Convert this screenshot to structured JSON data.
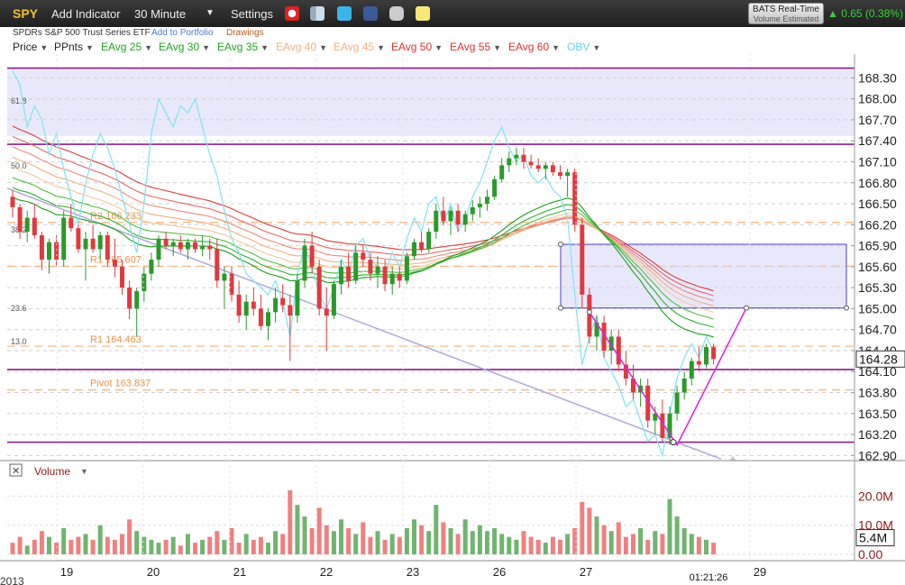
{
  "toolbar": {
    "symbol": "SPY",
    "add_indicator": "Add Indicator",
    "interval": "30 Minute",
    "settings": "Settings",
    "realtime_title": "BATS Real-Time",
    "realtime_sub": "Volume Estimated",
    "change": "0.65 (0.38%)",
    "change_arrow": "▲",
    "icons": [
      "alarm-clock-icon",
      "bookmark-icon",
      "twitter-icon",
      "facebook-icon",
      "camera-icon",
      "note-icon"
    ]
  },
  "subheader": {
    "name": "SPDRs S&P 500 Trust Series ETF",
    "add_portfolio": "Add to Portfolio",
    "drawings": "Drawings"
  },
  "indicators": [
    {
      "label": "Price",
      "color": "#222222"
    },
    {
      "label": "PPnts",
      "color": "#222222"
    },
    {
      "label": "EAvg 25",
      "color": "#1fa51f"
    },
    {
      "label": "EAvg 30",
      "color": "#1fa51f"
    },
    {
      "label": "EAvg 35",
      "color": "#1fa51f"
    },
    {
      "label": "EAvg 40",
      "color": "#f4b183"
    },
    {
      "label": "EAvg 45",
      "color": "#f4b183"
    },
    {
      "label": "EAvg 50",
      "color": "#e03030"
    },
    {
      "label": "EAvg 55",
      "color": "#e03030"
    },
    {
      "label": "EAvg 60",
      "color": "#e03030"
    },
    {
      "label": "OBV",
      "color": "#5bd6ea"
    }
  ],
  "colors": {
    "up": "#2a9a2a",
    "down": "#e0393f",
    "vol_up": "#6fb56f",
    "vol_down": "#f08080",
    "obv": "#7fe3f0",
    "channel": "#8c1e8c",
    "zone": "#e9e9fb",
    "pivot": "#f5b47a",
    "trend": "#b0a8d8",
    "pattern": "#e020e0"
  },
  "chart_data": {
    "type": "candlestick",
    "price_axis": {
      "ticks": [
        "168.30",
        "168.00",
        "167.70",
        "167.40",
        "167.10",
        "166.80",
        "166.50",
        "166.20",
        "165.90",
        "165.60",
        "165.30",
        "165.00",
        "164.70",
        "164.40",
        "164.10",
        "163.80",
        "163.50",
        "163.20",
        "162.90"
      ],
      "ylim": [
        162.84,
        168.64
      ],
      "current_price": "164.28"
    },
    "x_axis_labels": [
      "19",
      "20",
      "21",
      "22",
      "23",
      "26",
      "27",
      "29"
    ],
    "year_label": "2013",
    "timestamp": "01:21:26",
    "fib_labels": [
      "61.8",
      "50.0",
      "38.2",
      "23.6",
      "13.0"
    ],
    "pivots": [
      {
        "label": "R2 166.233",
        "value": 166.233
      },
      {
        "label": "R1 165.607",
        "value": 165.607
      },
      {
        "label": "R1 164.463",
        "value": 164.463
      },
      {
        "label": "Pivot 163.837",
        "value": 163.837
      }
    ],
    "horizontal_levels": [
      168.44,
      167.35,
      164.13,
      163.09
    ],
    "resistance_zone": {
      "from": 167.47,
      "to": 168.44
    },
    "box_zone": {
      "from": 165.01,
      "to": 165.92,
      "x_from": "26",
      "x_to": "29"
    },
    "volume_panel": {
      "title": "Volume",
      "ticks": [
        "20.0M",
        "10.0M",
        "0.00"
      ],
      "current": "5.4M",
      "ylim": [
        0,
        26
      ]
    },
    "candles": [
      [
        166.6,
        166.7,
        166.3,
        166.45
      ],
      [
        166.45,
        166.5,
        166.0,
        166.1
      ],
      [
        166.1,
        166.4,
        165.95,
        166.3
      ],
      [
        166.3,
        166.5,
        166.0,
        166.05
      ],
      [
        166.05,
        166.1,
        165.55,
        165.7
      ],
      [
        165.7,
        166.0,
        165.5,
        165.95
      ],
      [
        165.95,
        166.05,
        165.6,
        165.7
      ],
      [
        165.7,
        166.4,
        165.6,
        166.3
      ],
      [
        166.3,
        166.5,
        166.1,
        166.15
      ],
      [
        166.15,
        166.2,
        165.8,
        165.85
      ],
      [
        165.85,
        166.1,
        165.4,
        166.0
      ],
      [
        166.0,
        166.2,
        165.8,
        165.85
      ],
      [
        165.85,
        166.1,
        165.7,
        166.05
      ],
      [
        166.05,
        166.1,
        165.6,
        165.7
      ],
      [
        165.7,
        166.0,
        165.45,
        165.6
      ],
      [
        165.6,
        165.7,
        165.2,
        165.3
      ],
      [
        165.3,
        165.4,
        164.85,
        165.0
      ],
      [
        165.0,
        165.3,
        164.6,
        165.25
      ],
      [
        165.25,
        165.6,
        165.1,
        165.5
      ],
      [
        165.5,
        165.8,
        165.4,
        165.7
      ],
      [
        165.7,
        166.05,
        165.6,
        166.0
      ],
      [
        166.0,
        166.1,
        165.85,
        165.9
      ],
      [
        165.9,
        166.0,
        165.75,
        165.95
      ],
      [
        165.95,
        166.05,
        165.8,
        165.85
      ],
      [
        165.85,
        166.0,
        165.7,
        165.95
      ],
      [
        165.95,
        166.0,
        165.8,
        165.85
      ],
      [
        165.85,
        166.05,
        165.75,
        165.9
      ],
      [
        165.9,
        166.0,
        165.7,
        165.85
      ],
      [
        165.85,
        166.0,
        165.3,
        165.4
      ],
      [
        165.4,
        165.6,
        165.0,
        165.5
      ],
      [
        165.5,
        165.6,
        165.1,
        165.2
      ],
      [
        165.2,
        165.4,
        164.8,
        164.9
      ],
      [
        164.9,
        165.2,
        164.7,
        165.1
      ],
      [
        165.1,
        165.3,
        164.9,
        165.0
      ],
      [
        165.0,
        165.2,
        164.7,
        164.75
      ],
      [
        164.75,
        165.0,
        164.55,
        164.95
      ],
      [
        164.95,
        165.3,
        164.8,
        165.15
      ],
      [
        165.15,
        165.35,
        164.95,
        165.05
      ],
      [
        165.05,
        165.2,
        164.25,
        164.9
      ],
      [
        164.9,
        165.5,
        164.8,
        165.4
      ],
      [
        165.4,
        166.0,
        165.3,
        165.9
      ],
      [
        165.9,
        166.1,
        165.5,
        165.6
      ],
      [
        165.6,
        165.7,
        164.9,
        165.0
      ],
      [
        165.0,
        165.3,
        164.4,
        164.9
      ],
      [
        164.9,
        165.4,
        164.85,
        165.35
      ],
      [
        165.35,
        165.7,
        165.2,
        165.6
      ],
      [
        165.6,
        165.8,
        165.3,
        165.4
      ],
      [
        165.4,
        165.9,
        165.35,
        165.8
      ],
      [
        165.8,
        165.9,
        165.6,
        165.7
      ],
      [
        165.7,
        165.8,
        165.4,
        165.5
      ],
      [
        165.5,
        165.75,
        165.3,
        165.6
      ],
      [
        165.6,
        165.7,
        165.25,
        165.35
      ],
      [
        165.35,
        165.6,
        165.2,
        165.5
      ],
      [
        165.5,
        165.6,
        165.3,
        165.4
      ],
      [
        165.4,
        165.8,
        165.35,
        165.75
      ],
      [
        165.75,
        166.0,
        165.7,
        165.95
      ],
      [
        165.95,
        166.1,
        165.8,
        165.85
      ],
      [
        165.85,
        166.15,
        165.8,
        166.1
      ],
      [
        166.1,
        166.5,
        166.0,
        166.4
      ],
      [
        166.4,
        166.6,
        166.2,
        166.25
      ],
      [
        166.25,
        166.45,
        166.05,
        166.4
      ],
      [
        166.4,
        166.5,
        166.1,
        166.2
      ],
      [
        166.2,
        166.4,
        166.1,
        166.35
      ],
      [
        166.35,
        166.55,
        166.25,
        166.45
      ],
      [
        166.45,
        166.6,
        166.3,
        166.5
      ],
      [
        166.5,
        166.7,
        166.4,
        166.6
      ],
      [
        166.6,
        166.9,
        166.55,
        166.85
      ],
      [
        166.85,
        167.15,
        166.8,
        167.05
      ],
      [
        167.05,
        167.25,
        166.95,
        167.15
      ],
      [
        167.15,
        167.3,
        167.05,
        167.2
      ],
      [
        167.2,
        167.3,
        167.0,
        167.1
      ],
      [
        167.1,
        167.2,
        167.0,
        167.05
      ],
      [
        167.05,
        167.15,
        166.95,
        167.0
      ],
      [
        167.0,
        167.1,
        166.85,
        167.05
      ],
      [
        167.05,
        167.1,
        166.9,
        166.95
      ],
      [
        166.95,
        167.05,
        166.85,
        166.9
      ],
      [
        166.9,
        167.0,
        166.6,
        166.95
      ],
      [
        166.95,
        167.0,
        166.1,
        166.2
      ],
      [
        166.2,
        166.3,
        165.0,
        165.2
      ],
      [
        165.2,
        165.3,
        164.5,
        164.6
      ],
      [
        164.6,
        164.9,
        164.4,
        164.8
      ],
      [
        164.8,
        164.9,
        164.3,
        164.4
      ],
      [
        164.4,
        164.7,
        164.2,
        164.6
      ],
      [
        164.6,
        164.7,
        164.1,
        164.2
      ],
      [
        164.2,
        164.4,
        163.9,
        164.0
      ],
      [
        164.0,
        164.2,
        163.7,
        163.8
      ],
      [
        163.8,
        164.0,
        163.6,
        163.9
      ],
      [
        163.9,
        164.0,
        163.3,
        163.4
      ],
      [
        163.4,
        163.6,
        163.2,
        163.5
      ],
      [
        163.5,
        163.7,
        163.1,
        163.15
      ],
      [
        163.15,
        163.6,
        163.05,
        163.5
      ],
      [
        163.5,
        163.9,
        163.4,
        163.8
      ],
      [
        163.8,
        164.1,
        163.7,
        164.0
      ],
      [
        164.0,
        164.3,
        163.9,
        164.25
      ],
      [
        164.25,
        164.45,
        164.1,
        164.2
      ],
      [
        164.2,
        164.5,
        164.15,
        164.45
      ],
      [
        164.45,
        164.5,
        164.2,
        164.28
      ]
    ],
    "volume": [
      4,
      6,
      3,
      5,
      8,
      6,
      4,
      9,
      5,
      6,
      7,
      5,
      10,
      6,
      5,
      7,
      12,
      8,
      6,
      5,
      4,
      5,
      6,
      3,
      7,
      4,
      5,
      6,
      8,
      5,
      9,
      4,
      7,
      5,
      6,
      4,
      8,
      7,
      22,
      17,
      13,
      9,
      16,
      10,
      8,
      12,
      9,
      7,
      11,
      6,
      8,
      5,
      7,
      6,
      9,
      12,
      10,
      8,
      17,
      11,
      9,
      7,
      12,
      8,
      10,
      8,
      9,
      7,
      6,
      5,
      8,
      6,
      5,
      4,
      6,
      5,
      7,
      9,
      18,
      16,
      13,
      10,
      8,
      11,
      6,
      7,
      9,
      5,
      8,
      7,
      19,
      13,
      9,
      7,
      6,
      5,
      4
    ],
    "ema_series": [
      {
        "name": "EAvg 25",
        "period": 25
      },
      {
        "name": "EAvg 30",
        "period": 30
      },
      {
        "name": "EAvg 35",
        "period": 35
      },
      {
        "name": "EAvg 40",
        "period": 40
      },
      {
        "name": "EAvg 45",
        "period": 45
      },
      {
        "name": "EAvg 50",
        "period": 50
      },
      {
        "name": "EAvg 55",
        "period": 55
      },
      {
        "name": "EAvg 60",
        "period": 60
      }
    ],
    "obv_series": [
      168.4,
      168.2,
      167.6,
      167.9,
      167.7,
      167.2,
      167.5,
      167.0,
      166.6,
      166.2,
      166.8,
      167.2,
      167.5,
      167.3,
      167.0,
      166.6,
      166.2,
      165.8,
      166.5,
      167.5,
      168.0,
      167.8,
      167.6,
      167.9,
      167.8,
      168.0,
      167.6,
      167.2,
      166.9,
      166.4,
      166.0,
      165.8,
      165.5,
      165.4,
      165.3,
      165.2,
      165.4,
      165.1,
      164.6,
      165.5,
      165.9,
      165.6,
      165.2,
      165.0,
      165.3,
      165.7,
      165.5,
      165.9,
      166.0,
      165.7,
      165.6,
      165.5,
      165.8,
      165.6,
      166.0,
      166.3,
      166.1,
      166.5,
      166.6,
      166.2,
      166.5,
      166.1,
      166.3,
      166.6,
      166.8,
      167.1,
      167.4,
      167.6,
      167.3,
      167.1,
      167.2,
      166.9,
      166.8,
      166.9,
      166.7,
      166.6,
      166.3,
      165.2,
      164.2,
      164.6,
      164.9,
      164.3,
      164.1,
      163.9,
      163.6,
      163.7,
      163.4,
      163.1,
      163.2,
      162.9,
      163.5,
      164.0,
      164.3,
      164.5,
      164.3,
      164.6,
      164.4
    ]
  }
}
